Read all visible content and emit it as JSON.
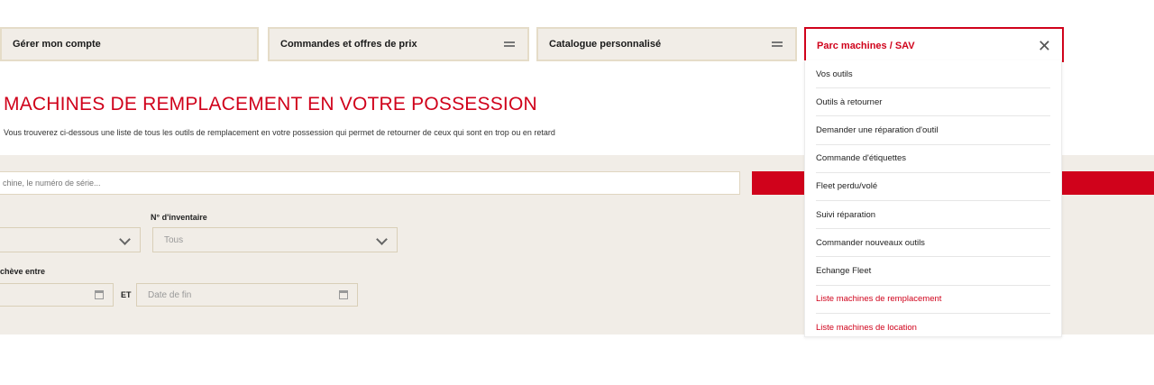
{
  "tabs": {
    "account": "Gérer mon compte",
    "orders": "Commandes et offres de prix",
    "catalog": "Catalogue personnalisé",
    "fleet": "Parc machines / SAV"
  },
  "page": {
    "title": "MACHINES DE REMPLACEMENT EN VOTRE POSSESSION",
    "subtitle": "Vous trouverez ci-dessous une liste de tous les outils de remplacement en votre possession qui permet de retourner de ceux qui sont en trop ou en retard"
  },
  "filters": {
    "search_placeholder": "chine, le numéro de série...",
    "inventory_label": "N° d'inventaire",
    "inventory_value": "Tous",
    "date_label": "chève entre",
    "et_label": "ET",
    "end_date_placeholder": "Date de fin"
  },
  "dropdown": {
    "items": [
      "Vos outils",
      "Outils à retourner",
      "Demander une réparation d'outil",
      "Commande d'étiquettes",
      "Fleet perdu/volé",
      "Suivi réparation",
      "Commander nouveaux outils",
      "Echange Fleet",
      "Liste machines de remplacement",
      "Liste machines de location"
    ]
  },
  "colors": {
    "accent": "#d0021b",
    "panel": "#f1ede7",
    "border": "#e5dcc8"
  },
  "icons": {
    "menu": "hamburger-icon",
    "close": "close-icon",
    "calendar": "calendar-icon",
    "chevron": "chevron-down-icon"
  }
}
